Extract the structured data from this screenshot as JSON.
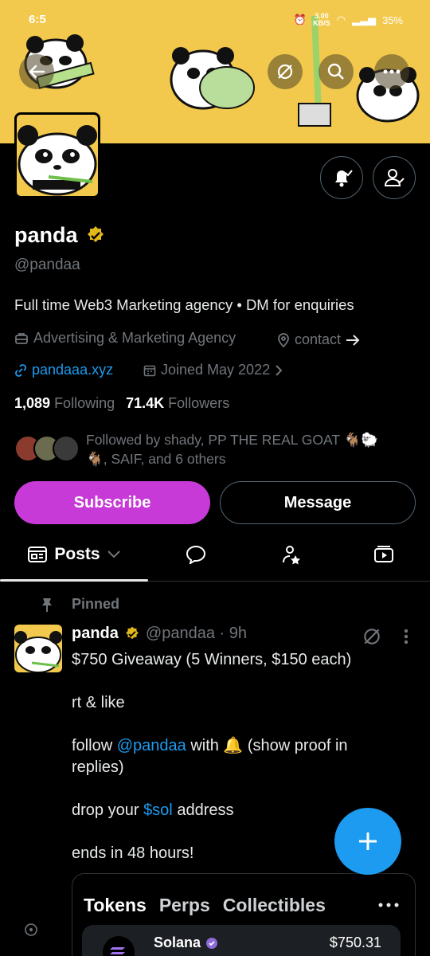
{
  "status_bar": {
    "time": "6:5",
    "net_speed": "3.00",
    "net_unit": "KB/S",
    "battery": "35%"
  },
  "profile": {
    "name": "panda",
    "handle": "@pandaa",
    "bio": "Full time Web3 Marketing agency • DM for enquiries",
    "category": "Advertising & Marketing Agency",
    "contact": "contact",
    "website": "pandaaa.xyz",
    "joined": "Joined May 2022",
    "following_count": "1,089",
    "following_label": "Following",
    "followers_count": "71.4K",
    "followers_label": "Followers",
    "followed_by_line1": "Followed by shady, PP THE REAL GOAT 🐐🐑",
    "followed_by_line2": "🐐, SAIF, and 6 others"
  },
  "actions": {
    "subscribe": "Subscribe",
    "message": "Message"
  },
  "tabs": {
    "posts": "Posts"
  },
  "post": {
    "pinned_label": "Pinned",
    "author": "panda",
    "handle_time": "@pandaa · 9h",
    "line1": "$750 Giveaway (5 Winners, $150 each)",
    "line2": "rt & like",
    "line3_pre": "follow",
    "line3_mention": "@pandaa",
    "line3_post": "with 🔔 (show proof in",
    "line3_cont": "replies)",
    "line4_pre": "drop your",
    "line4_tag": "$sol",
    "line4_post": "address",
    "line5": "ends in 48 hours!",
    "card": {
      "tabs": [
        "Tokens",
        "Perps",
        "Collectibles"
      ],
      "token_name": "Solana",
      "token_value": "$750.31"
    }
  },
  "colors": {
    "accent": "#1d9bf0",
    "subscribe": "#c73ad7",
    "banner": "#f2c94c",
    "verified": "#e2b719"
  }
}
